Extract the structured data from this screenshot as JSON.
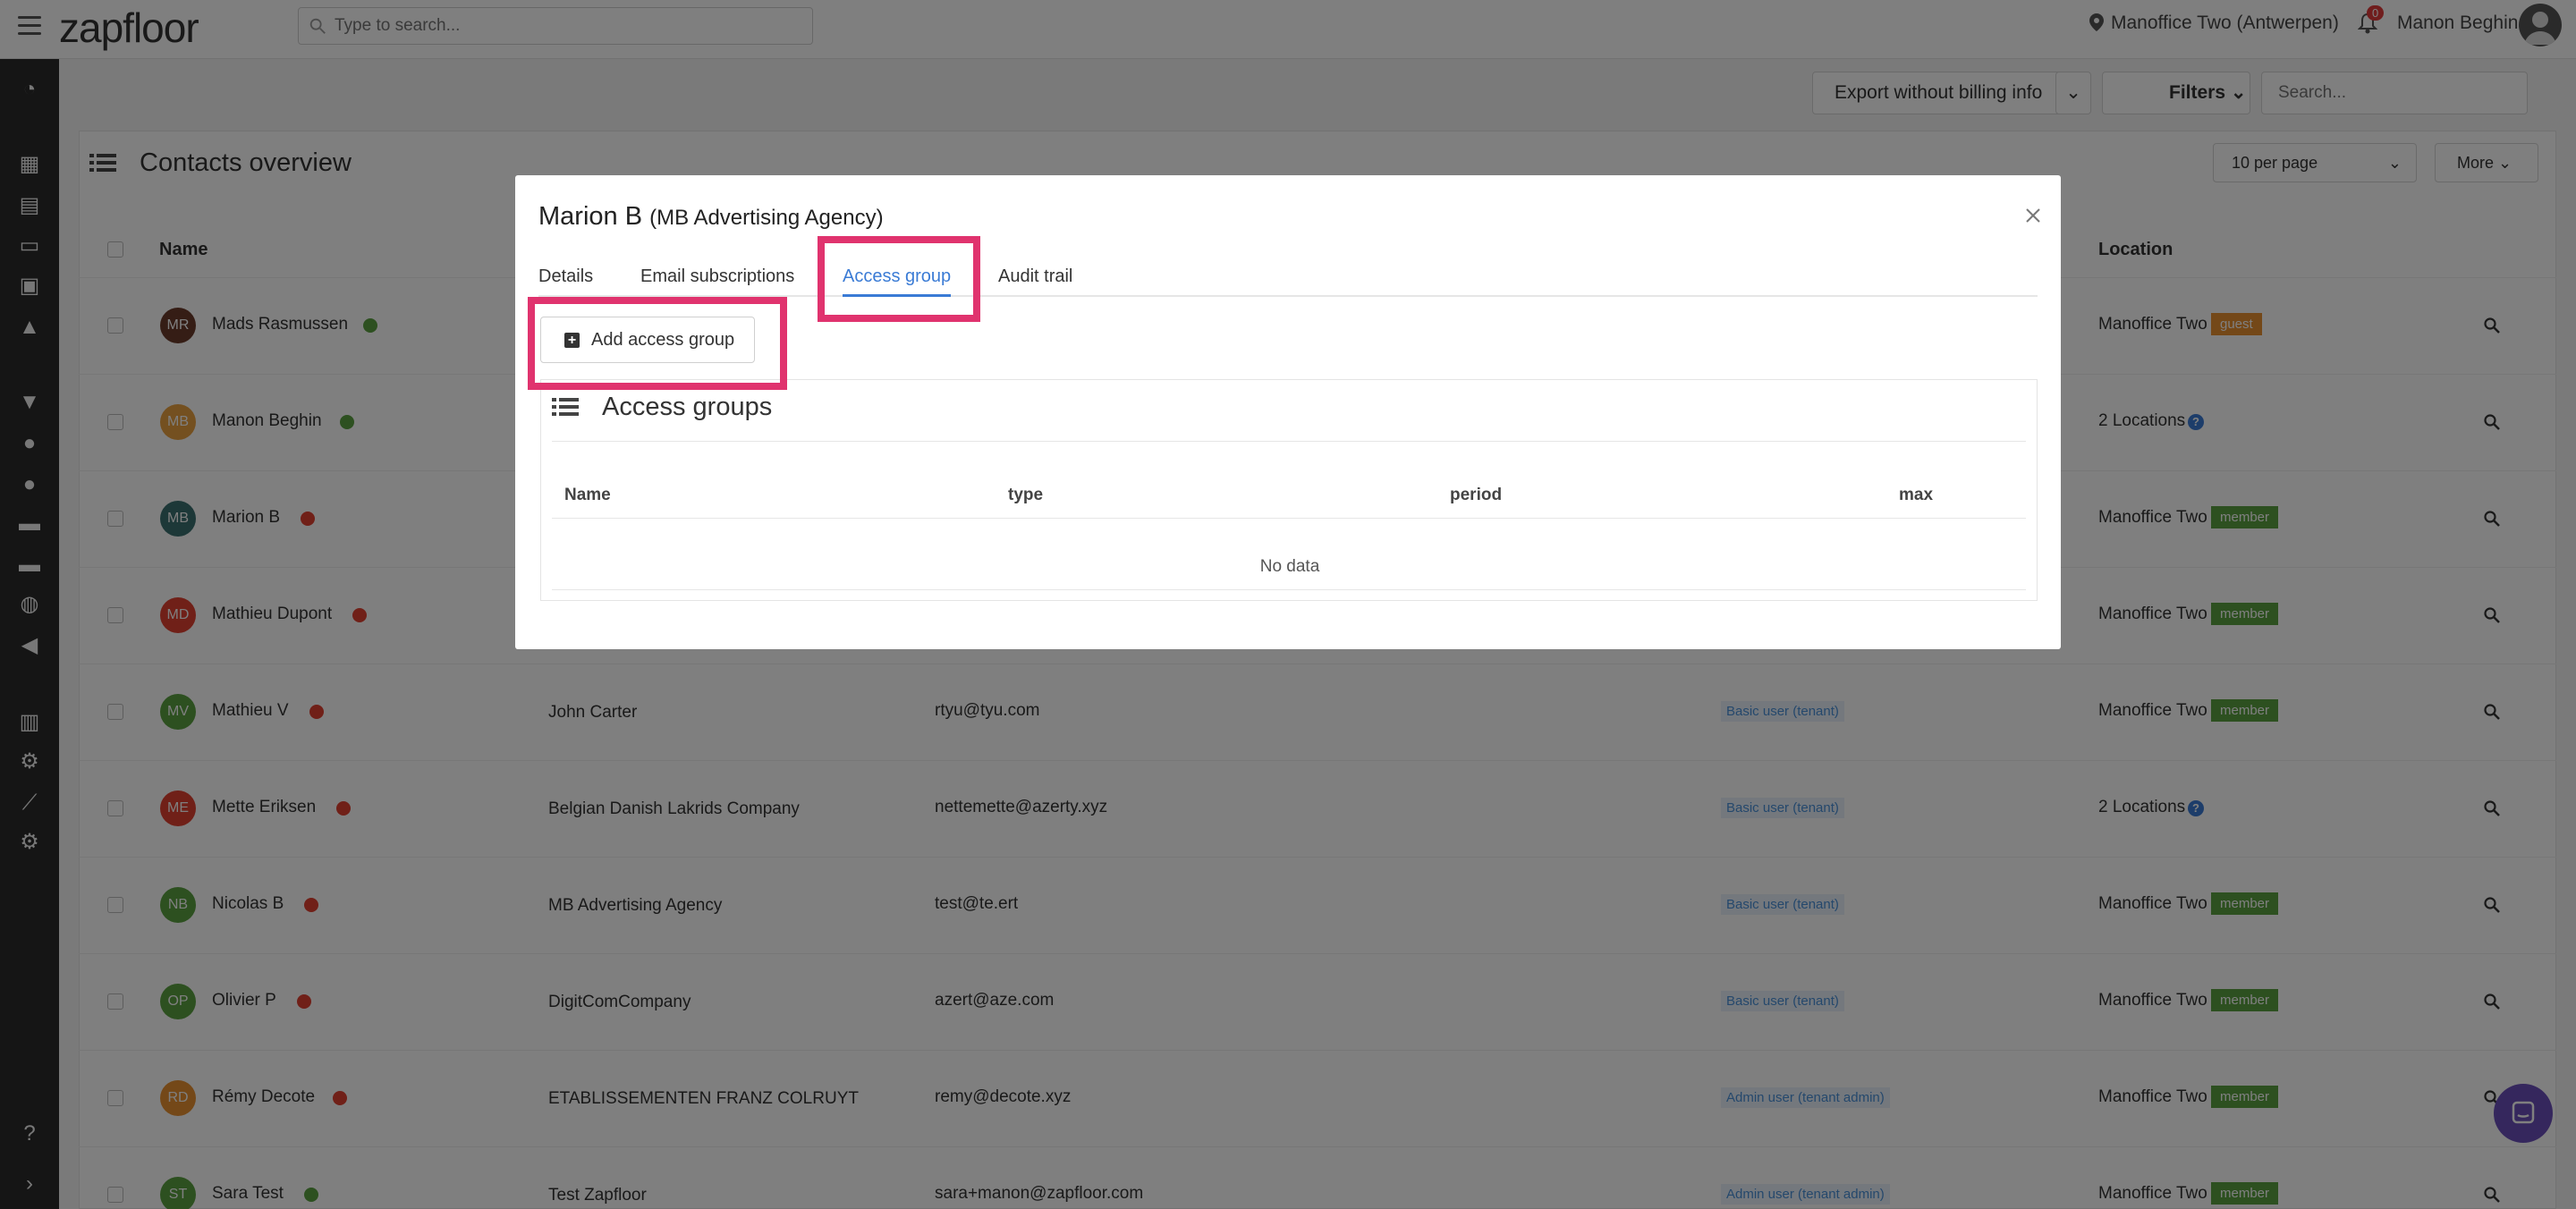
{
  "topbar": {
    "logo": "zapfloor",
    "search_placeholder": "Type to search...",
    "location": "Manoffice Two (Antwerpen)",
    "notification_count": "0",
    "user_name": "Manon Beghin"
  },
  "toolbar": {
    "export_label": "Export without billing info",
    "filters_label": "Filters",
    "search_placeholder": "Search..."
  },
  "contacts": {
    "title": "Contacts overview",
    "per_page": "10 per page",
    "more_label": "More",
    "columns": {
      "name": "Name",
      "location": "Location"
    },
    "rows": [
      {
        "initials": "MR",
        "name": "Mads Rasmussen",
        "status": "green",
        "company": "",
        "email": "",
        "role": "",
        "location": "Manoffice Two",
        "badge": "guest",
        "avatar_color": "#6b3a2a"
      },
      {
        "initials": "MB",
        "name": "Manon Beghin",
        "status": "green",
        "company": "",
        "email": "",
        "role": "",
        "location": "2 Locations",
        "badge": "",
        "avatar_color": "#e8a040"
      },
      {
        "initials": "MB",
        "name": "Marion B",
        "status": "red",
        "company": "",
        "email": "",
        "role": "",
        "location": "Manoffice Two",
        "badge": "member",
        "avatar_color": "#3a7070"
      },
      {
        "initials": "MD",
        "name": "Mathieu Dupont",
        "status": "red",
        "company": "",
        "email": "",
        "role": "",
        "location": "Manoffice Two",
        "badge": "member",
        "avatar_color": "#e04030"
      },
      {
        "initials": "MV",
        "name": "Mathieu V",
        "status": "red",
        "company": "John Carter",
        "email": "rtyu@tyu.com",
        "role": "Basic user (tenant)",
        "location": "Manoffice Two",
        "badge": "member",
        "avatar_color": "#5aa040"
      },
      {
        "initials": "ME",
        "name": "Mette Eriksen",
        "status": "red",
        "company": "Belgian Danish Lakrids Company",
        "email": "nettemette@azerty.xyz",
        "role": "Basic user (tenant)",
        "location": "2 Locations",
        "badge": "",
        "avatar_color": "#e04030"
      },
      {
        "initials": "NB",
        "name": "Nicolas B",
        "status": "red",
        "company": "MB Advertising Agency",
        "email": "test@te.ert",
        "role": "Basic user (tenant)",
        "location": "Manoffice Two",
        "badge": "member",
        "avatar_color": "#5aa040"
      },
      {
        "initials": "OP",
        "name": "Olivier P",
        "status": "red",
        "company": "DigitComCompany",
        "email": "azert@aze.com",
        "role": "Basic user (tenant)",
        "location": "Manoffice Two",
        "badge": "member",
        "avatar_color": "#5aa040"
      },
      {
        "initials": "RD",
        "name": "Rémy Decote",
        "status": "red",
        "company": "ETABLISSEMENTEN FRANZ COLRUYT",
        "email": "remy@decote.xyz",
        "role": "Admin user (tenant admin)",
        "location": "Manoffice Two",
        "badge": "member",
        "avatar_color": "#e89030"
      },
      {
        "initials": "ST",
        "name": "Sara Test",
        "status": "green",
        "company": "Test Zapfloor",
        "email": "sara+manon@zapfloor.com",
        "role": "Admin user (tenant admin)",
        "location": "Manoffice Two",
        "badge": "member",
        "avatar_color": "#5aa040"
      }
    ]
  },
  "modal": {
    "name": "Marion B",
    "organization": "(MB Advertising Agency)",
    "tabs": [
      "Details",
      "Email subscriptions",
      "Access group",
      "Audit trail"
    ],
    "active_tab": "Access group",
    "add_button": "Add access group",
    "section_title": "Access groups",
    "columns": [
      "Name",
      "type",
      "period",
      "max"
    ],
    "empty_text": "No data"
  },
  "colors": {
    "highlight": "#e0336e",
    "accent": "#3a7bd5",
    "member_badge": "#5aa040",
    "guest_badge": "#e89030",
    "status_green": "#5aa040",
    "status_red": "#e04030"
  }
}
